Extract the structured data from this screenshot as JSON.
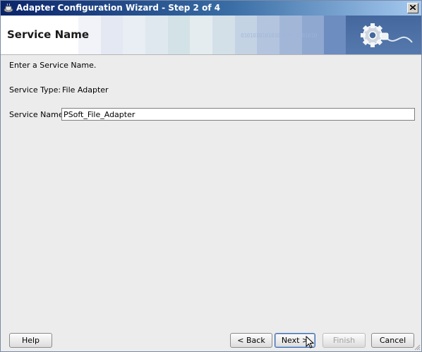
{
  "window": {
    "title": "Adapter Configuration Wizard - Step 2 of 4"
  },
  "banner": {
    "heading": "Service Name",
    "binary_text": "0101010101010101010101010"
  },
  "form": {
    "instructions": "Enter a Service Name.",
    "service_type_label": "Service Type:",
    "service_type_value": "File Adapter",
    "service_name_label": "Service Name:",
    "service_name_value": "PSoft_File_Adapter"
  },
  "buttons": {
    "help": "Help",
    "back": "< Back",
    "next": "Next >",
    "finish": "Finish",
    "cancel": "Cancel"
  },
  "colors": {
    "titlebar_start": "#0a246a",
    "banner_panel": "#44689e",
    "window_bg": "#ececec"
  }
}
